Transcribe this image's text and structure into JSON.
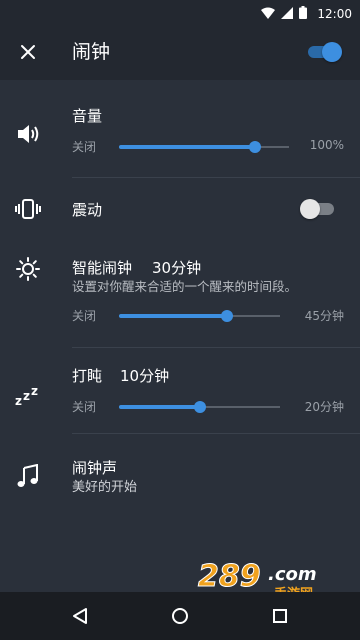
{
  "status_bar": {
    "time": "12:00"
  },
  "app_bar": {
    "title": "闹钟",
    "alarm_enabled": true
  },
  "volume": {
    "title": "音量",
    "min_label": "关闭",
    "max_label": "100%",
    "level_fraction": 0.8
  },
  "vibrate": {
    "title": "震动",
    "enabled": false
  },
  "smart_alarm": {
    "title": "智能闹钟",
    "value": "30分钟",
    "description": "设置对你醒来合适的一个醒来的时间段。",
    "min_label": "关闭",
    "max_label": "45分钟",
    "level_fraction": 0.67
  },
  "snooze": {
    "title": "打盹",
    "value": "10分钟",
    "min_label": "关闭",
    "max_label": "20分钟",
    "level_fraction": 0.5
  },
  "ringtone": {
    "title": "闹钟声",
    "value": "美好的开始"
  },
  "watermark": {
    "text": "289.com",
    "sub": "手游网"
  },
  "colors": {
    "accent": "#3d8fe0",
    "background": "#2a303a",
    "bar": "#232830"
  }
}
